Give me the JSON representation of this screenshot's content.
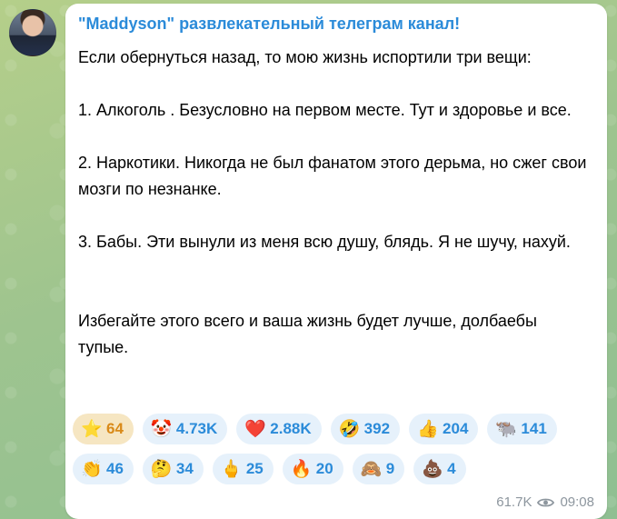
{
  "channel": {
    "name": "\"Maddyson\" развлекательный телеграм канал!"
  },
  "post": {
    "intro": "Если обернуться назад, то мою жизнь испортили три вещи:",
    "item1": "1. Алкоголь . Безусловно на первом месте. Тут и здоровье и все.",
    "item2": "2. Наркотики. Никогда не был фанатом этого дерьма, но сжег свои мозги по незнанке.",
    "item3": "3. Бабы. Эти вынули из меня всю душу, блядь. Я не шучу, нахуй.",
    "outro": "Избегайте этого всего и ваша жизнь будет лучше, долбаебы тупые."
  },
  "reactions": {
    "row1": [
      {
        "icon": "star-icon",
        "glyph": "⭐",
        "count": "64",
        "active": true
      },
      {
        "icon": "clown-icon",
        "glyph": "🤡",
        "count": "4.73K"
      },
      {
        "icon": "heart-icon",
        "glyph": "❤️",
        "count": "2.88K"
      },
      {
        "icon": "rofl-icon",
        "glyph": "🤣",
        "count": "392"
      },
      {
        "icon": "thumbs-up-icon",
        "glyph": "👍",
        "count": "204"
      },
      {
        "icon": "bull-icon",
        "glyph": "🐃",
        "count": "141"
      }
    ],
    "row2": [
      {
        "icon": "clapping-icon",
        "glyph": "👏",
        "count": "46"
      },
      {
        "icon": "thinking-icon",
        "glyph": "🤔",
        "count": "34"
      },
      {
        "icon": "middle-finger-icon",
        "glyph": "🖕",
        "count": "25"
      },
      {
        "icon": "fire-icon",
        "glyph": "🔥",
        "count": "20"
      },
      {
        "icon": "see-no-evil-monkey-icon",
        "glyph": "🙈",
        "count": "9"
      },
      {
        "icon": "poop-icon",
        "glyph": "💩",
        "count": "4"
      }
    ]
  },
  "footer": {
    "views": "61.7K",
    "time": "09:08"
  },
  "colors": {
    "accent": "#2b8bd9",
    "reaction_bg": "#e6f1fb",
    "active_reaction_bg": "#f6e6c2",
    "meta_text": "#8d969e"
  }
}
